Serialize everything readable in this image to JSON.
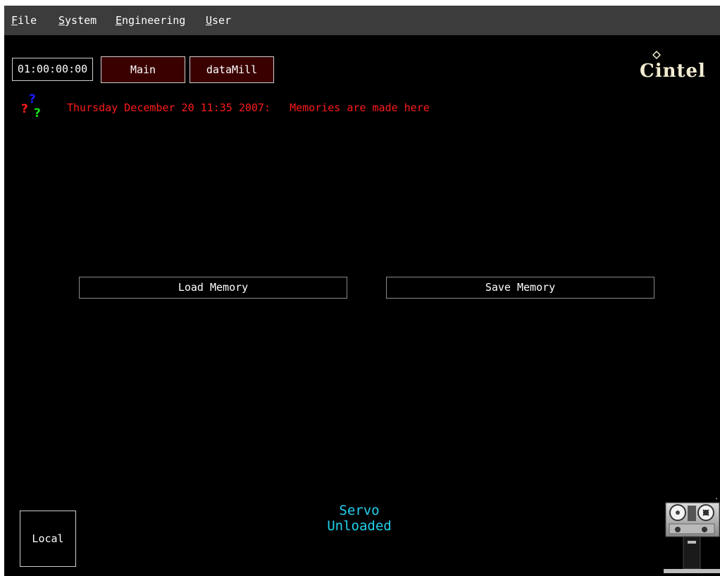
{
  "menu": {
    "items": [
      {
        "accel": "F",
        "rest": "ile"
      },
      {
        "accel": "S",
        "rest": "ystem"
      },
      {
        "accel": "E",
        "rest": "ngineering"
      },
      {
        "accel": "U",
        "rest": "ser"
      }
    ]
  },
  "toolbar": {
    "timecode": "01:00:00:00",
    "main_label": "Main",
    "datamill_label": "dataMill"
  },
  "logo": {
    "text": "Cintel"
  },
  "status": {
    "datetime": "Thursday December 20 11:35 2007:",
    "message": "Memories are made here"
  },
  "memory": {
    "load_label": "Load Memory",
    "save_label": "Save Memory"
  },
  "servo": {
    "line1": "Servo",
    "line2": "Unloaded"
  },
  "local_label": "Local",
  "colors": {
    "background": "#000000",
    "menubar": "#3c3c3c",
    "button_bg": "#3a0000",
    "status_text": "#ff1a1a",
    "servo_text": "#22d0ee",
    "logo": "#f2ecd2"
  },
  "icons": {
    "help": "question-marks-icon",
    "machine": "telecine-machine-icon"
  }
}
